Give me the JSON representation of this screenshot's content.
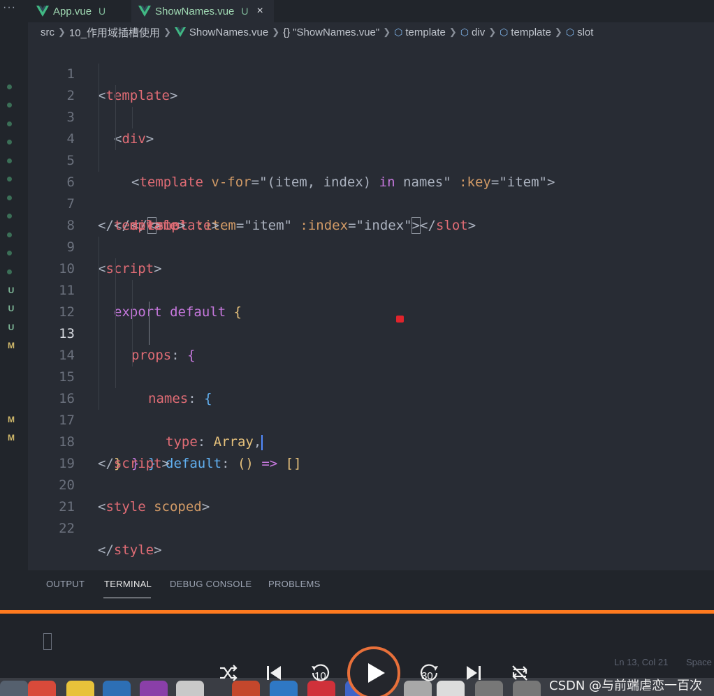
{
  "tabs": [
    {
      "label": "App.vue",
      "status": "U"
    },
    {
      "label": "ShowNames.vue",
      "status": "U",
      "close": "×"
    }
  ],
  "tab_overflow": "···",
  "breadcrumb": [
    "src",
    "10_作用域插槽使用",
    "ShowNames.vue",
    "\"ShowNames.vue\"",
    "template",
    "div",
    "template",
    "slot"
  ],
  "git_markers": [
    "U",
    "U",
    "U",
    "M",
    "M",
    "M"
  ],
  "code": {
    "current_line": 13,
    "lines": [
      {
        "n": "1"
      },
      {
        "n": "2"
      },
      {
        "n": "3"
      },
      {
        "n": "4"
      },
      {
        "n": "5"
      },
      {
        "n": "6"
      },
      {
        "n": "7"
      },
      {
        "n": "8"
      },
      {
        "n": "9"
      },
      {
        "n": "10"
      },
      {
        "n": "11"
      },
      {
        "n": "12"
      },
      {
        "n": "13"
      },
      {
        "n": "14"
      },
      {
        "n": "15"
      },
      {
        "n": "16"
      },
      {
        "n": "17"
      },
      {
        "n": "18"
      },
      {
        "n": "19"
      },
      {
        "n": "20"
      },
      {
        "n": "21"
      },
      {
        "n": "22"
      }
    ],
    "tokens": {
      "l1": [
        "<",
        "template",
        ">"
      ],
      "l2": [
        "<",
        "div",
        ">"
      ],
      "l3": [
        "<",
        "template",
        " ",
        "v-for",
        "=",
        "\"(item, index) ",
        "in",
        " names\"",
        " ",
        ":key",
        "=",
        "\"item\"",
        ">"
      ],
      "l4": [
        "<",
        "slot",
        " ",
        ":item",
        "=",
        "\"item\"",
        " ",
        ":index",
        "=",
        "\"index\"",
        ">",
        "</",
        "slot",
        ">"
      ],
      "l5": [
        "</",
        "template",
        ">"
      ],
      "l6": [
        "</",
        "div",
        ">"
      ],
      "l7": [
        "</",
        "template",
        ">"
      ],
      "l9": [
        "<",
        "script",
        ">"
      ],
      "l10": [
        "export",
        " ",
        "default",
        " ",
        "{"
      ],
      "l11": [
        "props",
        ":",
        " ",
        "{"
      ],
      "l12": [
        "names",
        ":",
        " ",
        "{"
      ],
      "l13": [
        "type",
        ":",
        " ",
        "Array",
        ","
      ],
      "l14": [
        "default",
        ":",
        " ",
        "()",
        " ",
        "=>",
        " ",
        "[]"
      ],
      "l15": [
        "}"
      ],
      "l16": [
        "}"
      ],
      "l17": [
        "}"
      ],
      "l18": [
        "</",
        "script",
        ">"
      ],
      "l20": [
        "<",
        "style",
        " ",
        "scoped",
        ">"
      ],
      "l22": [
        "</",
        "style",
        ">"
      ]
    }
  },
  "panel_tabs": [
    "OUTPUT",
    "TERMINAL",
    "DEBUG CONSOLE",
    "PROBLEMS"
  ],
  "panel_active": "TERMINAL",
  "status_bar": {
    "position": "Ln 13, Col 21",
    "indent": "Space"
  },
  "player": {
    "rewind_label": "10",
    "forward_label": "30"
  },
  "watermark": "CSDN @与前端虐恋一百次",
  "colors": {
    "progress": "#ff7a1f",
    "tag": "#e06c75",
    "string": "#98c379",
    "keyword": "#c678dd",
    "attribute": "#d19a66"
  }
}
